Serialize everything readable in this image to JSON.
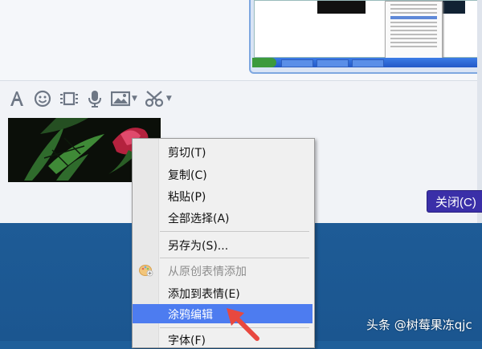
{
  "toolbar": {
    "icons": [
      "font-icon",
      "emoji-icon",
      "video-icon",
      "microphone-icon",
      "image-icon",
      "scissors-icon"
    ]
  },
  "buttons": {
    "close_label": "关闭(C)"
  },
  "context_menu": {
    "items": [
      {
        "label": "剪切(T)",
        "enabled": true
      },
      {
        "label": "复制(C)",
        "enabled": true
      },
      {
        "label": "粘贴(P)",
        "enabled": true
      },
      {
        "label": "全部选择(A)",
        "enabled": true
      },
      {
        "label": "另存为(S)...",
        "enabled": true
      },
      {
        "label": "从原创表情添加",
        "enabled": false,
        "icon": "palette-add-icon"
      },
      {
        "label": "添加到表情(E)",
        "enabled": true
      },
      {
        "label": "涂鸦编辑",
        "enabled": true,
        "selected": true
      },
      {
        "label": "字体(F)",
        "enabled": true
      }
    ]
  },
  "watermark": {
    "text": "头条 @树莓果冻qjc"
  },
  "colors": {
    "menu_highlight": "#4d7cf0",
    "close_button": "#3a2fa8",
    "arrow": "#e8483f",
    "desktop": "#1f5f9a"
  }
}
